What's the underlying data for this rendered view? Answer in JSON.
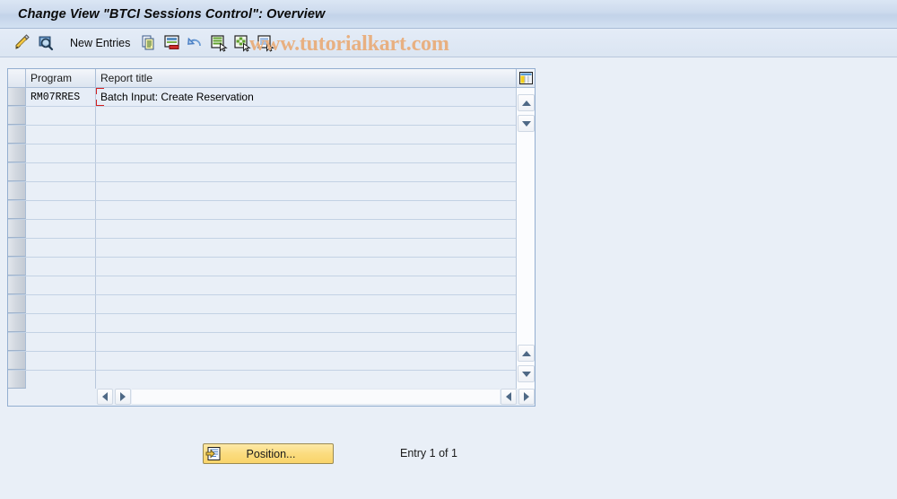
{
  "window": {
    "title": "Change View \"BTCI Sessions Control\": Overview"
  },
  "toolbar": {
    "new_entries_label": "New Entries",
    "icons": [
      {
        "name": "pencil-edit-icon",
        "title": "Change"
      },
      {
        "name": "magnifier-display-icon",
        "title": "Display"
      },
      {
        "name": "copy-as-icon",
        "title": "Copy As..."
      },
      {
        "name": "delete-row-icon",
        "title": "Delete"
      },
      {
        "name": "undo-icon",
        "title": "Undo Change"
      },
      {
        "name": "select-all-icon",
        "title": "Select All"
      },
      {
        "name": "deselect-all-icon",
        "title": "Deselect All"
      },
      {
        "name": "details-icon",
        "title": "Details"
      }
    ]
  },
  "watermark": {
    "text": "www.tutorialkart.com",
    "color": "#e8b081"
  },
  "table": {
    "columns": [
      {
        "key": "program",
        "label": "Program"
      },
      {
        "key": "report_title",
        "label": "Report title"
      }
    ],
    "rows": [
      {
        "program": "RM07RRES",
        "report_title": "Batch Input: Create Reservation"
      }
    ],
    "empty_row_count": 16,
    "config_icon": "table-settings-icon",
    "scroll": {
      "up_icon": "scroll-up-icon",
      "down_icon": "scroll-down-icon",
      "left_icon": "scroll-left-icon",
      "right_icon": "scroll-right-icon"
    }
  },
  "footer": {
    "position_button_label": "Position...",
    "position_button_icon": "position-icon",
    "entry_status": "Entry 1 of 1"
  },
  "colors": {
    "background": "#e9eff7",
    "titlebar": "#ccdaed",
    "grid_border": "#93aed0",
    "focus_marker": "#d32020",
    "button_yellow": "#fbdc7f"
  }
}
